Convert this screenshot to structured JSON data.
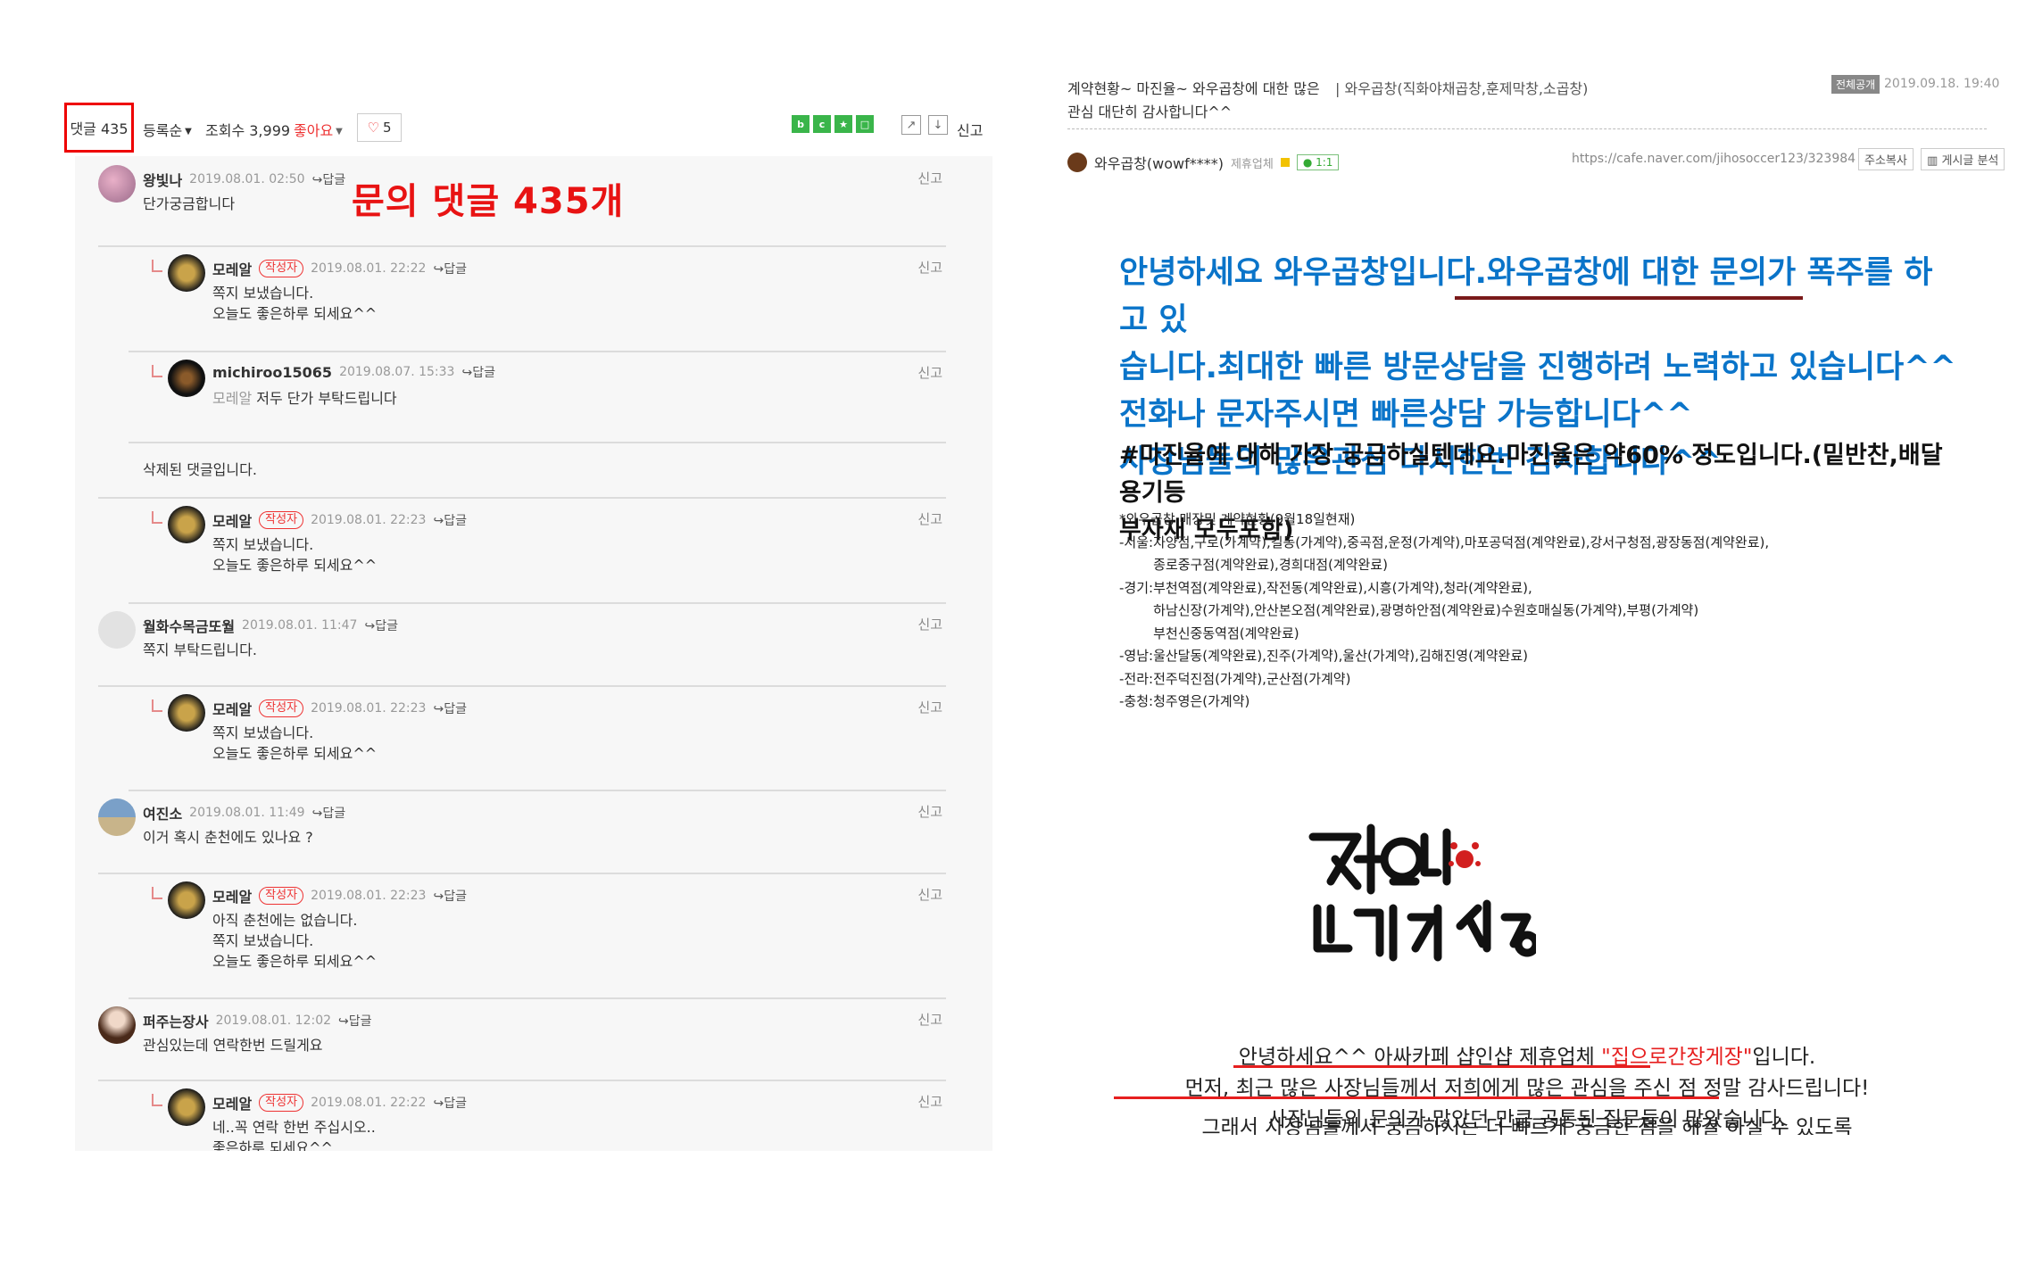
{
  "left": {
    "toolbar": {
      "comment_count": "댓글 435",
      "sort": "등록순",
      "views": "조회수 3,999",
      "likes_label": "좋아요",
      "heart_count": "5",
      "report": "신고"
    },
    "annotation": "문의 댓글 435개",
    "comments": [
      {
        "nick": "왕빛나",
        "date": "2019.08.01. 02:50",
        "reply": "답글",
        "body": "단가궁금합니다",
        "report": "신고"
      },
      {
        "nick": "모레알",
        "badge": "작성자",
        "date": "2019.08.01. 22:22",
        "reply": "답글",
        "body": "쪽지 보냈습니다.\n오늘도 좋은하루 되세요^^",
        "report": "신고"
      },
      {
        "nick": "michiroo15065",
        "date": "2019.08.07. 15:33",
        "reply": "답글",
        "mention": "모레알",
        "body": "저두 단가 부탁드립니다",
        "report": "신고"
      },
      {
        "deleted": "삭제된 댓글입니다."
      },
      {
        "nick": "모레알",
        "badge": "작성자",
        "date": "2019.08.01. 22:23",
        "reply": "답글",
        "body": "쪽지 보냈습니다.\n오늘도 좋은하루 되세요^^",
        "report": "신고"
      },
      {
        "nick": "월화수목금또월",
        "date": "2019.08.01. 11:47",
        "reply": "답글",
        "body": "쪽지 부탁드립니다.",
        "report": "신고"
      },
      {
        "nick": "모레알",
        "badge": "작성자",
        "date": "2019.08.01. 22:23",
        "reply": "답글",
        "body": "쪽지 보냈습니다.\n오늘도 좋은하루 되세요^^",
        "report": "신고"
      },
      {
        "nick": "여진소",
        "date": "2019.08.01. 11:49",
        "reply": "답글",
        "body": "이거 혹시 춘천에도 있나요 ?",
        "report": "신고"
      },
      {
        "nick": "모레알",
        "badge": "작성자",
        "date": "2019.08.01. 22:23",
        "reply": "답글",
        "body": "아직 춘천에는 없습니다.\n쪽지 보냈습니다.\n오늘도 좋은하루 되세요^^",
        "report": "신고"
      },
      {
        "nick": "퍼주는장사",
        "date": "2019.08.01. 12:02",
        "reply": "답글",
        "body": "관심있는데 연락한번 드릴게요",
        "report": "신고"
      },
      {
        "nick": "모레알",
        "badge": "작성자",
        "date": "2019.08.01. 22:22",
        "reply": "답글",
        "body": "네..꼭 연락 한번 주십시오..\n좋은하루 되세요^^",
        "report": "신고"
      }
    ]
  },
  "right": {
    "title_line1": "계약현황~ 마진율~ 와우곱창에 대한 많은",
    "title_line2": "관심 대단히 감사합니다^^",
    "menu": "와우곱창(직화야채곱창,훈제막창,소곱창)",
    "public_badge": "전체공개",
    "date": "2019.09.18. 19:40",
    "author": "와우곱창(wowf****)",
    "partner": "제휴업체",
    "chat": "1:1",
    "url": "https://cafe.naver.com/jihosoccer123/323984",
    "copy_btn": "주소복사",
    "analysis_btn": "게시글 분석",
    "blue_lines": [
      "안녕하세요 와우곱창입니다.와우곱창에 대한 문의가 폭주를 하고 있",
      "습니다.최대한 빠른 방문상담을 진행하려 노력하고 있습니다^^",
      "전화나 문자주시면 빠른상담 가능합니다^^",
      "사장님들의 많은관심 다시한번 감사합니다^^"
    ],
    "black_lines": [
      "#마진율에 대해 가장 궁금하실텐데요.마진율은 약60% 정도입니다.(밑반찬,배달용기등",
      "부자재 모두포함)"
    ],
    "list_lines": [
      "*와우곱창 매장및 계약현황(9월18일현재)",
      "-서울:자양점,구로(가계약),길동(가계약),중곡점,운정(가계약),마포공덕점(계약완료),강서구청점,광장동점(계약완료),",
      "        종로중구점(계약완료),경희대점(계약완료)",
      "-경기:부천역점(계약완료),작전동(계약완료),시흥(가계약),청라(계약완료),",
      "        하남신장(가계약),안산본오점(계약완료),광명하안점(계약완료)수원호매실동(가계약),부평(가계약)",
      "        부천신중동역점(계약완료)",
      "-영남:울산달동(계약완료),진주(가계약),울산(가계약),김해진영(계약완료)",
      "-전라:전주덕진점(가계약),군산점(가계약)",
      "-충청:청주영은(가계약)"
    ],
    "logo_text": "집으로간장게장",
    "bottom": {
      "line1_a": "안녕하세요^^ 아싸카페 샵인샵 제휴업체 ",
      "line1_red": "\"집으로간장게장\"",
      "line1_b": "입니다.",
      "line2": "먼저, 최근 많은 사장님들께서 저희에게 많은 관심을 주신 점 정말 감사드립니다!",
      "line3": "사장님들의 문의가 많았던 만큼 공통된 질문들이 많았습니다.",
      "line4": "그래서 사장님들께서 궁금하시는 더 빠르게 궁금한 점을 해결 하실 수 있도록"
    }
  }
}
